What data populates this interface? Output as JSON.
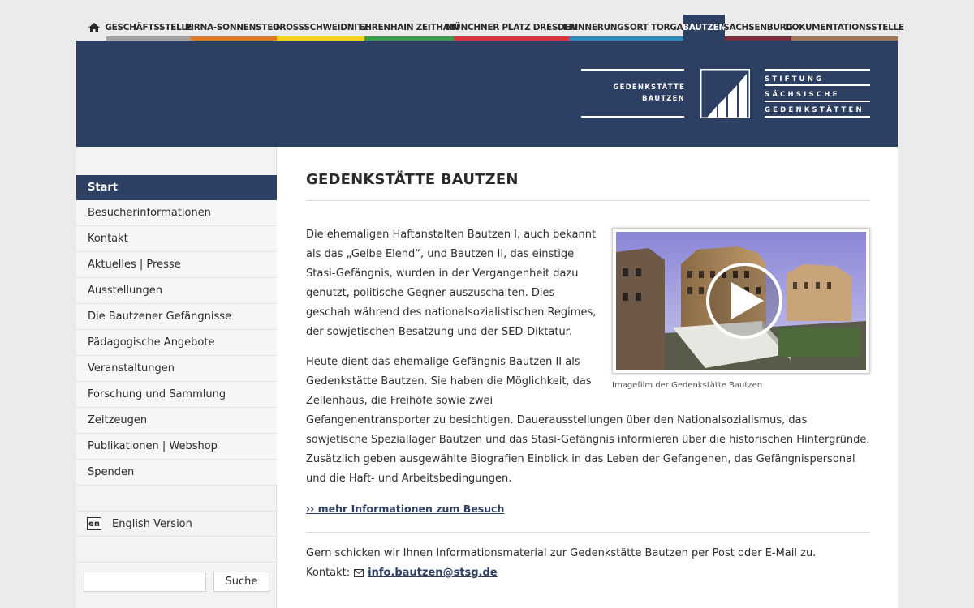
{
  "nav": {
    "home_icon": "home-icon",
    "tabs": [
      {
        "label": "GESCHÄFTSSTELLE",
        "color": "#a5a29d"
      },
      {
        "label": "PIRNA-SONNENSTEIN",
        "color": "#e07a28"
      },
      {
        "label": "GROSSSCHWEIDNITZ",
        "color": "#f2cf18"
      },
      {
        "label": "EHRENHAIN ZEITHAIN",
        "color": "#3a9e4c"
      },
      {
        "label": "MÜNCHNER PLATZ DRESDEN",
        "color": "#d9333b"
      },
      {
        "label": "ERINNERUNGSORT TORGAU",
        "color": "#2e8bb9"
      },
      {
        "label": "BAUTZEN",
        "color": "#2d3f62"
      },
      {
        "label": "SACHSENBURG",
        "color": "#7a2e3b"
      },
      {
        "label": "DOKUMENTATIONSSTELLE",
        "color": "#9b7a55"
      }
    ],
    "active": "BAUTZEN"
  },
  "header": {
    "logo_left": [
      "GEDENKSTÄTTE",
      "BAUTZEN"
    ],
    "logo_right": [
      "STIFTUNG",
      "SÄCHSISCHE",
      "GEDENKSTÄTTEN"
    ],
    "bg_color": "#2d3f62"
  },
  "sidebar": {
    "items": [
      {
        "label": "Start"
      },
      {
        "label": "Besucherinformationen"
      },
      {
        "label": "Kontakt"
      },
      {
        "label": "Aktuelles | Presse"
      },
      {
        "label": "Ausstellungen"
      },
      {
        "label": "Die Bautzener Gefängnisse"
      },
      {
        "label": "Pädagogische Angebote"
      },
      {
        "label": "Veranstaltungen"
      },
      {
        "label": "Forschung und Sammlung"
      },
      {
        "label": "Zeitzeugen"
      },
      {
        "label": "Publikationen | Webshop"
      },
      {
        "label": "Spenden"
      }
    ],
    "active": "Start",
    "language": {
      "flag": "en",
      "label": "English Version"
    },
    "search": {
      "button": "Suche",
      "value": ""
    }
  },
  "main": {
    "title": "GEDENKSTÄTTE BAUTZEN",
    "para1": "Die ehemaligen Haftanstalten Bautzen I, auch bekannt als das „Gelbe Elend“, und Bautzen II, das einstige Stasi-Gefängnis, wurden in der Vergangenheit dazu genutzt, politische Gegner auszuschalten. Dies geschah während des nationalsozialistischen Regimes, der sowjetischen Besatzung und der SED-Diktatur.",
    "para2_lead": "Heute dient das ehemalige Gefängnis Bautzen II als Gedenkstätte Bautzen. Sie haben die Möglichkeit, das Zellenhaus, die Freihöfe sowie zwei",
    "para2_rest": "Gefangenentransporter zu besichtigen. Dauerausstellungen über den Nationalsozialismus, das sowjetische Speziallager Bautzen und das Stasi-Gefängnis informieren über die historischen Hintergründe. Zusätzlich geben ausgewählte Biografien Einblick in das Leben der Gefangenen, das Gefängnispersonal und die Haft- und Arbeitsbedingungen.",
    "video_caption": "Imagefilm der Gedenkstätte Bautzen",
    "more_link": "›› mehr Informationen zum Besuch",
    "para3": "Gern schicken wir Ihnen Informationsmaterial zur Gedenkstätte Bautzen per Post oder E-Mail zu.",
    "contact_label": "Kontakt:",
    "email": "info.bautzen@stsg.de"
  }
}
